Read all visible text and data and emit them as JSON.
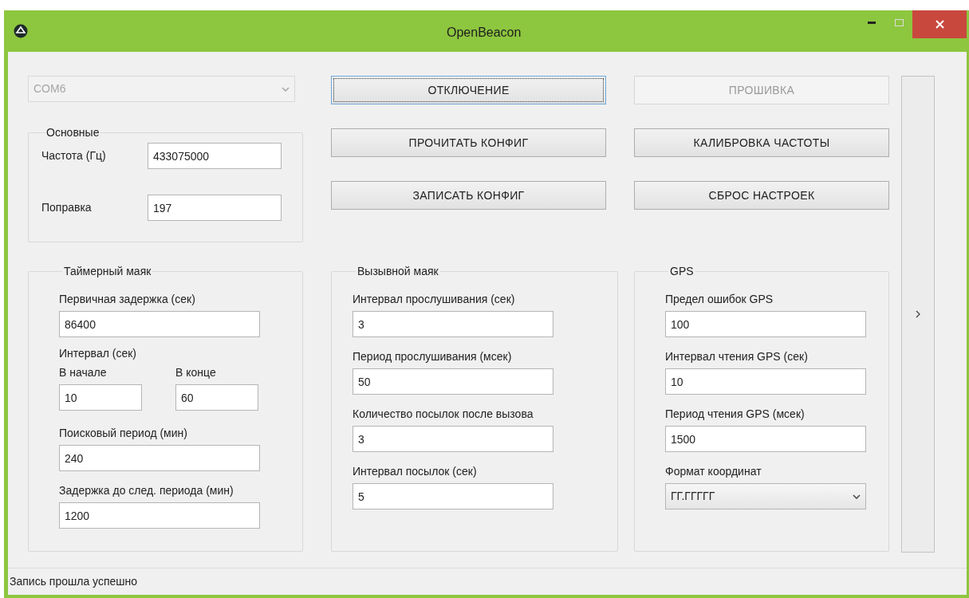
{
  "window": {
    "title": "OpenBeacon"
  },
  "port_select": {
    "value": "COM6",
    "disabled": true
  },
  "basic_group": {
    "title": "Основные",
    "fields": [
      {
        "label": "Частота (Гц)",
        "value": "433075000"
      },
      {
        "label": "Поправка",
        "value": "197"
      }
    ]
  },
  "middle_buttons": [
    {
      "label": "ОТКЛЮЧЕНИЕ",
      "disabled": false,
      "focused": true
    },
    {
      "label": "ПРОЧИТАТЬ КОНФИГ",
      "disabled": false,
      "focused": false
    },
    {
      "label": "ЗАПИСАТЬ КОНФИГ",
      "disabled": false,
      "focused": false
    }
  ],
  "right_buttons": [
    {
      "label": "ПРОШИВКА",
      "disabled": true,
      "focused": false
    },
    {
      "label": "КАЛИБРОВКА ЧАСТОТЫ",
      "disabled": false,
      "focused": false
    },
    {
      "label": "СБРОС НАСТРОЕК",
      "disabled": false,
      "focused": false
    }
  ],
  "groups": [
    {
      "title": "Таймерный маяк",
      "items": [
        {
          "kind": "field",
          "label": "Первичная задержка (сек)",
          "value": "86400"
        },
        {
          "kind": "heading",
          "label": "Интервал (сек)"
        },
        {
          "kind": "pair",
          "fields": [
            {
              "label": "В начале",
              "value": "10"
            },
            {
              "label": "В конце",
              "value": "60"
            }
          ]
        },
        {
          "kind": "field",
          "label": "Поисковый период (мин)",
          "value": "240"
        },
        {
          "kind": "field",
          "label": "Задержка до след. периода (мин)",
          "value": "1200"
        }
      ]
    },
    {
      "title": "Вызывной маяк",
      "items": [
        {
          "kind": "field",
          "label": "Интервал прослушивания (сек)",
          "value": "3"
        },
        {
          "kind": "field",
          "label": "Период прослушивания (мсек)",
          "value": "50"
        },
        {
          "kind": "field",
          "label": "Количество посылок после вызова",
          "value": "3"
        },
        {
          "kind": "field",
          "label": "Интервал посылок (сек)",
          "value": "5"
        }
      ]
    },
    {
      "title": "GPS",
      "items": [
        {
          "kind": "field",
          "label": "Предел ошибок GPS",
          "value": "100"
        },
        {
          "kind": "field",
          "label": "Интервал чтения GPS (сек)",
          "value": "10"
        },
        {
          "kind": "field",
          "label": "Период чтения GPS (мсек)",
          "value": "1500"
        },
        {
          "kind": "select",
          "label": "Формат координат",
          "value": "ГГ.ГГГГГ"
        }
      ]
    }
  ],
  "status_bar": {
    "text": "Запись прошла успешно"
  }
}
